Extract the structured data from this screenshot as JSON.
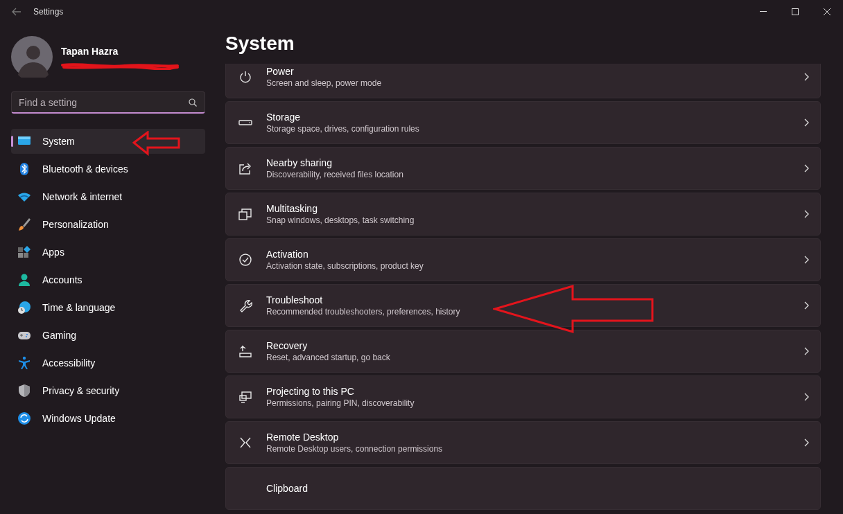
{
  "window": {
    "title": "Settings"
  },
  "user": {
    "name": "Tapan Hazra"
  },
  "search": {
    "placeholder": "Find a setting"
  },
  "sidebar": {
    "items": [
      {
        "label": "System",
        "selected": true
      },
      {
        "label": "Bluetooth & devices",
        "selected": false
      },
      {
        "label": "Network & internet",
        "selected": false
      },
      {
        "label": "Personalization",
        "selected": false
      },
      {
        "label": "Apps",
        "selected": false
      },
      {
        "label": "Accounts",
        "selected": false
      },
      {
        "label": "Time & language",
        "selected": false
      },
      {
        "label": "Gaming",
        "selected": false
      },
      {
        "label": "Accessibility",
        "selected": false
      },
      {
        "label": "Privacy & security",
        "selected": false
      },
      {
        "label": "Windows Update",
        "selected": false
      }
    ]
  },
  "page": {
    "title": "System"
  },
  "cards": [
    {
      "title": "Power",
      "subtitle": "Screen and sleep, power mode"
    },
    {
      "title": "Storage",
      "subtitle": "Storage space, drives, configuration rules"
    },
    {
      "title": "Nearby sharing",
      "subtitle": "Discoverability, received files location"
    },
    {
      "title": "Multitasking",
      "subtitle": "Snap windows, desktops, task switching"
    },
    {
      "title": "Activation",
      "subtitle": "Activation state, subscriptions, product key"
    },
    {
      "title": "Troubleshoot",
      "subtitle": "Recommended troubleshooters, preferences, history"
    },
    {
      "title": "Recovery",
      "subtitle": "Reset, advanced startup, go back"
    },
    {
      "title": "Projecting to this PC",
      "subtitle": "Permissions, pairing PIN, discoverability"
    },
    {
      "title": "Remote Desktop",
      "subtitle": "Remote Desktop users, connection permissions"
    },
    {
      "title": "Clipboard"
    }
  ]
}
